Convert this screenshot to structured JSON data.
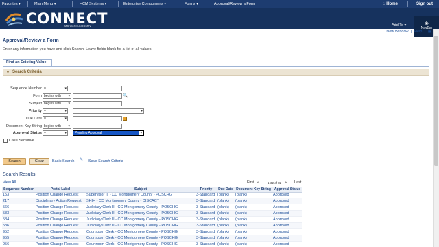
{
  "topnav": {
    "menus": [
      "Favorites",
      "Main Menu",
      "HCM Systems",
      "Enterprise Components",
      "Forms",
      "Approval/Review a Form"
    ],
    "home": "Home",
    "signout": "Sign out"
  },
  "header": {
    "logo_text": "CONNECT",
    "logo_sub": "Maryland Judiciary",
    "add_to": "Add To",
    "navbar": "NavBar"
  },
  "top_links": {
    "new_window": "New Window",
    "help": "Help",
    "sep": "|"
  },
  "page": {
    "title": "Approval/Review a Form",
    "instructions": "Enter any information you have and click Search. Leave fields blank for a list of all values."
  },
  "tab": {
    "label": "Find an Existing Value"
  },
  "criteria": {
    "title": "Search Criteria",
    "sequence_label": "Sequence Number",
    "sequence_op": "=",
    "form_label": "Form",
    "form_op": "begins with",
    "subject_label": "Subject",
    "subject_op": "begins with",
    "priority_label": "Priority",
    "priority_op": "=",
    "due_label": "Due Date",
    "due_op": "=",
    "dockey_label": "Document Key String",
    "dockey_op": "begins with",
    "approval_label": "Approval Status",
    "approval_op": "=",
    "approval_value": "Pending Approval",
    "case_sensitive": "Case Sensitive"
  },
  "actions": {
    "search": "Search",
    "clear": "Clear",
    "basic_search": "Basic Search",
    "save_search": "Save Search Criteria"
  },
  "results": {
    "title": "Search Results",
    "view_all": "View All",
    "first": "First",
    "range": "1-32 of 32",
    "last": "Last",
    "columns": [
      "Sequence Number",
      "Portal Label",
      "Subject",
      "Priority",
      "Due Date",
      "Document Key String",
      "Approval Status"
    ],
    "rows": [
      [
        "153",
        "Position Change Request",
        "Supervisor III - CC Montgomery County - POSCHG",
        "3-Standard",
        "(blank)",
        "(blank)",
        "Approved"
      ],
      [
        "217",
        "Disciplinary Action Request",
        "SHIH - CC Montgomery County - DISCACT",
        "3-Standard",
        "(blank)",
        "(blank)",
        "Approved"
      ],
      [
        "566",
        "Position Change Request",
        "Judiciary Clerk II - CC Montgomery County - POSCHG",
        "3-Standard",
        "(blank)",
        "(blank)",
        "Approved"
      ],
      [
        "583",
        "Position Change Request",
        "Judiciary Clerk II - CC Montgomery County - POSCHG",
        "3-Standard",
        "(blank)",
        "(blank)",
        "Approved"
      ],
      [
        "584",
        "Position Change Request",
        "Judiciary Clerk II - CC Montgomery County - POSCHG",
        "3-Standard",
        "(blank)",
        "(blank)",
        "Approved"
      ],
      [
        "586",
        "Position Change Request",
        "Judiciary Clerk II - CC Montgomery County - POSCHG",
        "3-Standard",
        "(blank)",
        "(blank)",
        "Approved"
      ],
      [
        "952",
        "Position Change Request",
        "Courtroom Clerk - CC Montgomery County - POSCHG",
        "3-Standard",
        "(blank)",
        "(blank)",
        "Approved"
      ],
      [
        "955",
        "Position Change Request",
        "Courtroom Clerk - CC Montgomery County - POSCHG",
        "3-Standard",
        "(blank)",
        "(blank)",
        "Approved"
      ],
      [
        "956",
        "Position Change Request",
        "Courtroom Clerk - CC Montgomery County - POSCHG",
        "3-Standard",
        "(blank)",
        "(blank)",
        "Approved"
      ]
    ]
  }
}
